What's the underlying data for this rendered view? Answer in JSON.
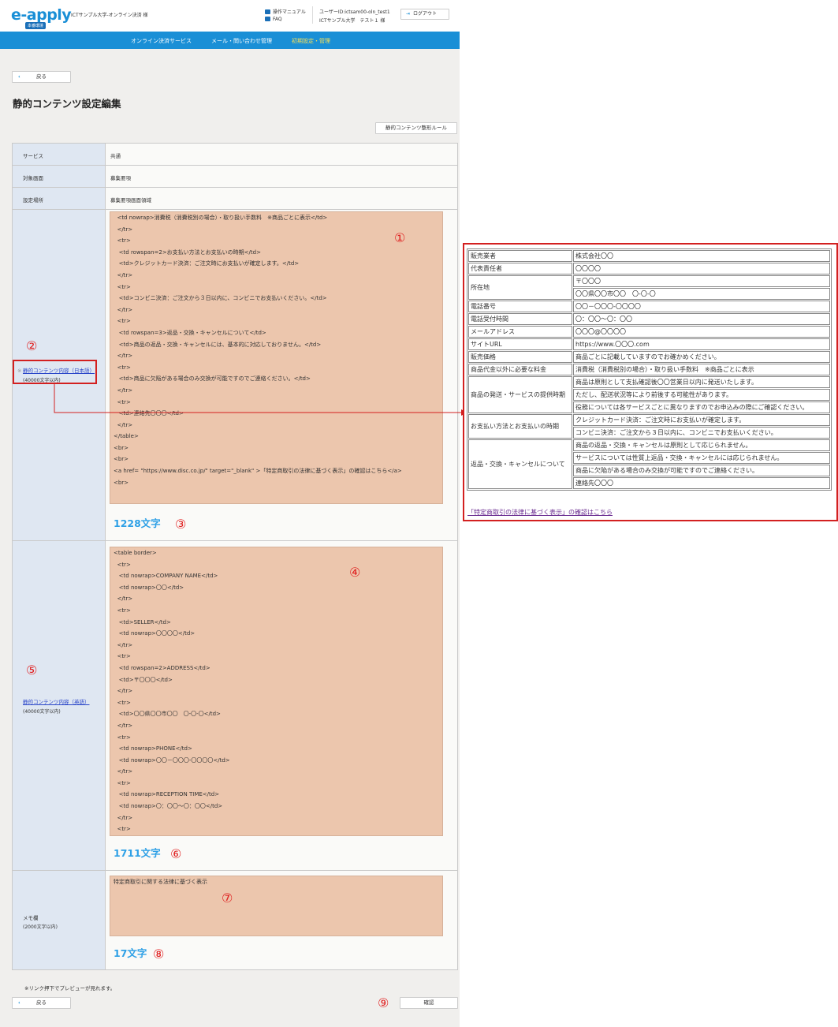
{
  "header": {
    "logo": "e-apply",
    "logo_badge": "本番環境",
    "university": "ICTサンプル大学-オンライン決済 様",
    "manual_link": "操作マニュアル",
    "faq_link": "FAQ",
    "user_id": "ユーザーID:ictsam00-oln_test1",
    "user_name": "ICTサンプル大学　テスト１ 様",
    "logout": "ログアウト"
  },
  "nav": [
    "オンライン決済サービス",
    "メール・問い合わせ管理",
    "初期設定・管理"
  ],
  "back_label": "戻る",
  "page_title": "静的コンテンツ設定編集",
  "rules_button": "静的コンテンツ整形ルール",
  "form": {
    "service_label": "サービス",
    "service_value": "共通",
    "screen_label": "対象画面",
    "screen_value": "募集要項",
    "location_label": "設定場所",
    "location_value": "募集要項画面領域",
    "jp_mark": "※",
    "jp_label": "静的コンテンツ内容（日本語）",
    "jp_limit": "(40000文字以内)",
    "jp_code": [
      "  <td nowrap>消費税（消費税別の場合）・取り扱い手数料　※商品ごとに表示</td>",
      "  </tr>",
      "  <tr>",
      "   <td rowspan=2>お支払い方法とお支払いの時期</td>",
      "   <td>クレジットカード決済：ご注文時にお支払いが確定します。</td>",
      "  </tr>",
      "  <tr>",
      "   <td>コンビニ決済：ご注文から３日以内に、コンビニでお支払いください。</td>",
      "  </tr>",
      "  <tr>",
      "   <td rowspan=3>返品・交換・キャンセルについて</td>",
      "   <td>商品の返品・交換・キャンセルには、基本的に対応しておりません。</td>",
      "  </tr>",
      "  <tr>",
      "   <td>商品に欠陥がある場合のみ交換が可能ですのでご連絡ください。</td>",
      "  </tr>",
      "  <tr>",
      "   <td>連絡先〇〇〇</td>",
      "  </tr>",
      "</table>",
      "<br>",
      "<br>",
      "<a href= \"https://www.disc.co.jp/\" target=\"_blank\" >「特定商取引の法律に基づく表示」の確認はこちら</a>",
      "<br>"
    ],
    "jp_count": "1228文字",
    "en_label": "静的コンテンツ内容（英語）",
    "en_limit": "(40000文字以内)",
    "en_code": [
      "<table border>",
      "  <tr>",
      "   <td nowrap>COMPANY NAME</td>",
      "   <td nowrap>〇〇</td>",
      "  </tr>",
      "  <tr>",
      "   <td>SELLER</td>",
      "   <td nowrap>〇〇〇〇</td>",
      "  </tr>",
      "  <tr>",
      "   <td rowspan=2>ADDRESS</td>",
      "   <td>〒〇〇〇</td>",
      "  </tr>",
      "  <tr>",
      "   <td>〇〇県〇〇市〇〇　〇-〇-〇</td>",
      "  </tr>",
      "  <tr>",
      "   <td nowrap>PHONE</td>",
      "   <td nowrap>〇〇－〇〇〇-〇〇〇〇</td>",
      "  </tr>",
      "  <tr>",
      "   <td nowrap>RECEPTION TIME</td>",
      "   <td nowrap>〇：〇〇～〇：〇〇</td>",
      "  </tr>",
      "  <tr>"
    ],
    "en_count": "1711文字",
    "memo_label": "メモ欄",
    "memo_limit": "(2000文字以内)",
    "memo_value": "特定商取引に関する法律に基づく表示",
    "memo_count": "17文字"
  },
  "note": "※リンク押下でプレビューが見れます。",
  "confirm_label": "確認",
  "circles": [
    "①",
    "②",
    "③",
    "④",
    "⑤",
    "⑥",
    "⑦",
    "⑧",
    "⑨"
  ],
  "preview": {
    "rows": [
      [
        "販売業者",
        "株式会社〇〇"
      ],
      [
        "代表責任者",
        "〇〇〇〇"
      ],
      [
        "所在地",
        "〒〇〇〇"
      ],
      [
        "",
        "〇〇県〇〇市〇〇　〇-〇-〇"
      ],
      [
        "電話番号",
        "〇〇－〇〇〇-〇〇〇〇"
      ],
      [
        "電話受付時間",
        "〇：〇〇～〇：〇〇"
      ],
      [
        "メールアドレス",
        "〇〇〇@〇〇〇〇"
      ],
      [
        "サイトURL",
        "https://www.〇〇〇.com"
      ],
      [
        "販売価格",
        "商品ごとに記載していますのでお確かめください。"
      ],
      [
        "商品代金以外に必要な料金",
        "消費税（消費税別の場合）・取り扱い手数料　※商品ごとに表示"
      ],
      [
        "商品の発送・サービスの提供時期",
        "商品は原則として支払確認後〇〇営業日以内に発送いたします。"
      ],
      [
        "",
        "ただし、配送状況等により前後する可能性があります。"
      ],
      [
        "",
        "役務については各サービスごとに異なりますのでお申込みの際にご確認ください。"
      ],
      [
        "お支払い方法とお支払いの時期",
        "クレジットカード決済：ご注文時にお支払いが確定します。"
      ],
      [
        "",
        "コンビニ決済：ご注文から３日以内に、コンビニでお支払いください。"
      ],
      [
        "返品・交換・キャンセルについて",
        "商品の返品・交換・キャンセルは原則として応じられません。"
      ],
      [
        "",
        "サービスについては性質上返品・交換・キャンセルには応じられません。"
      ],
      [
        "",
        "商品に欠陥がある場合のみ交換が可能ですのでご連絡ください。"
      ],
      [
        "",
        "連絡先〇〇〇"
      ]
    ],
    "link_text": "「特定商取引の法律に基づく表示」の確認はこちら"
  }
}
